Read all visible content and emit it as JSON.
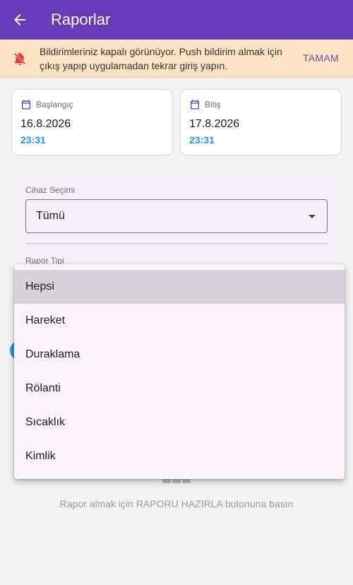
{
  "appbar": {
    "title": "Raporlar",
    "back_icon": "arrow-back-icon"
  },
  "banner": {
    "icon": "notifications-off-icon",
    "text": "Bildirimleriniz kapalı görünüyor. Push bildirim almak için çıkış yapıp uygulamadan tekrar giriş yapın.",
    "action": "TAMAM",
    "color": "#fde3c5"
  },
  "start": {
    "label": "Başlangıç",
    "date": "16.8.2026",
    "time": "23:31"
  },
  "end": {
    "label": "Bitiş",
    "date": "17.8.2026",
    "time": "23:31"
  },
  "filters": {
    "device_label": "Cihaz Seçimi",
    "device_value": "Tümü",
    "report_type_label": "Rapor Tipi"
  },
  "dropdown": {
    "options": [
      "Hepsi",
      "Hareket",
      "Duraklama",
      "Rölanti",
      "Sıcaklık",
      "Kimlik"
    ],
    "selected": "Hepsi"
  },
  "empty": {
    "text": "Rapor almak için RAPORU HAZIRLA butonuna basın"
  },
  "colors": {
    "primary": "#673ab7",
    "accent": "#2196f3",
    "warning": "#e53935"
  }
}
